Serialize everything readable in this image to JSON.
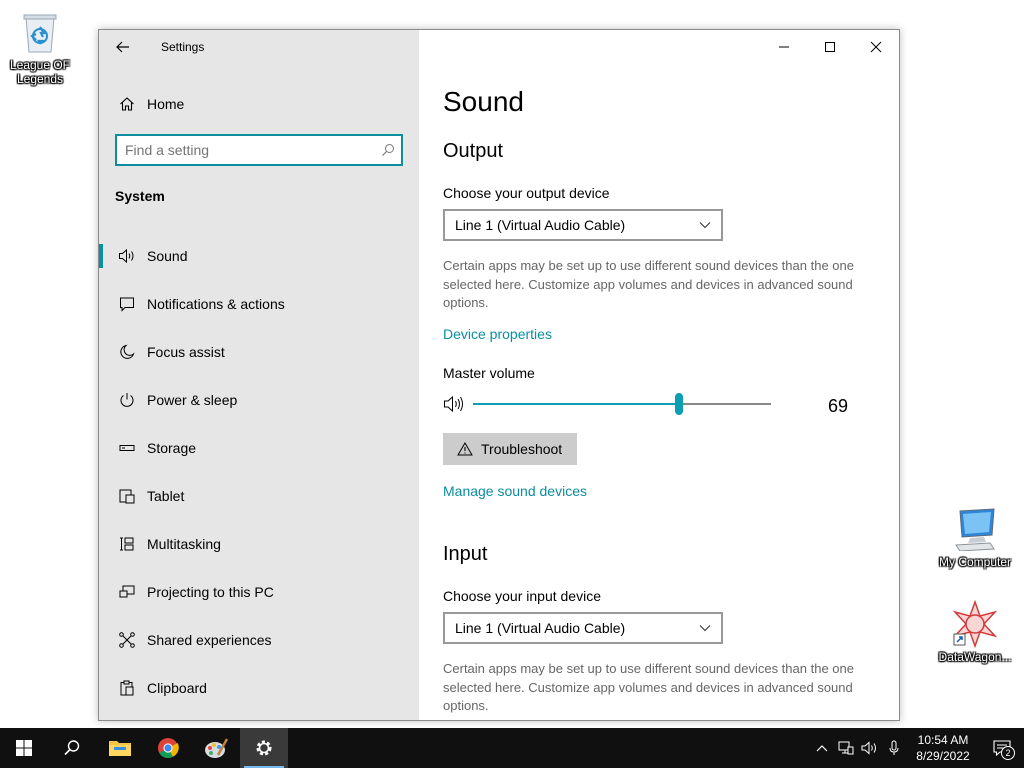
{
  "desktop": {
    "icons": [
      {
        "label": "League OF Legends",
        "icon": "recycle-bin-icon"
      },
      {
        "label": "My Computer",
        "icon": "computer-icon"
      },
      {
        "label": "DataWagon...",
        "icon": "datawagon-shortcut-icon"
      }
    ]
  },
  "window": {
    "title": "Settings",
    "controls": [
      "minimize",
      "maximize",
      "close"
    ]
  },
  "sidebar": {
    "home_label": "Home",
    "search_placeholder": "Find a setting",
    "section_title": "System",
    "items": [
      {
        "label": "Sound",
        "icon": "speaker-icon",
        "active": true
      },
      {
        "label": "Notifications & actions",
        "icon": "notification-icon"
      },
      {
        "label": "Focus assist",
        "icon": "moon-icon"
      },
      {
        "label": "Power & sleep",
        "icon": "power-icon"
      },
      {
        "label": "Storage",
        "icon": "storage-icon"
      },
      {
        "label": "Tablet",
        "icon": "tablet-icon"
      },
      {
        "label": "Multitasking",
        "icon": "multitasking-icon"
      },
      {
        "label": "Projecting to this PC",
        "icon": "projecting-icon"
      },
      {
        "label": "Shared experiences",
        "icon": "shared-experiences-icon"
      },
      {
        "label": "Clipboard",
        "icon": "clipboard-icon"
      }
    ]
  },
  "content": {
    "page_title": "Sound",
    "output": {
      "heading": "Output",
      "device_label": "Choose your output device",
      "device_value": "Line 1 (Virtual Audio Cable)",
      "description": "Certain apps may be set up to use different sound devices than the one selected here. Customize app volumes and devices in advanced sound options.",
      "device_properties_link": "Device properties",
      "volume_label": "Master volume",
      "volume_value": "69",
      "volume_fraction": 0.69,
      "troubleshoot_label": "Troubleshoot",
      "manage_link": "Manage sound devices"
    },
    "input": {
      "heading": "Input",
      "device_label": "Choose your input device",
      "device_value": "Line 1 (Virtual Audio Cable)",
      "description": "Certain apps may be set up to use different sound devices than the one selected here. Customize app volumes and devices in advanced sound options."
    }
  },
  "taskbar": {
    "apps": [
      "start-icon",
      "search-icon",
      "file-explorer-icon",
      "chrome-icon",
      "paint-icon",
      "settings-icon"
    ],
    "time": "10:54 AM",
    "date": "8/29/2022",
    "notification_count": "2"
  },
  "colors": {
    "accent": "#0a8ea0",
    "sidebar_bg": "#e6e6e6",
    "taskbar_bg": "#101010"
  }
}
